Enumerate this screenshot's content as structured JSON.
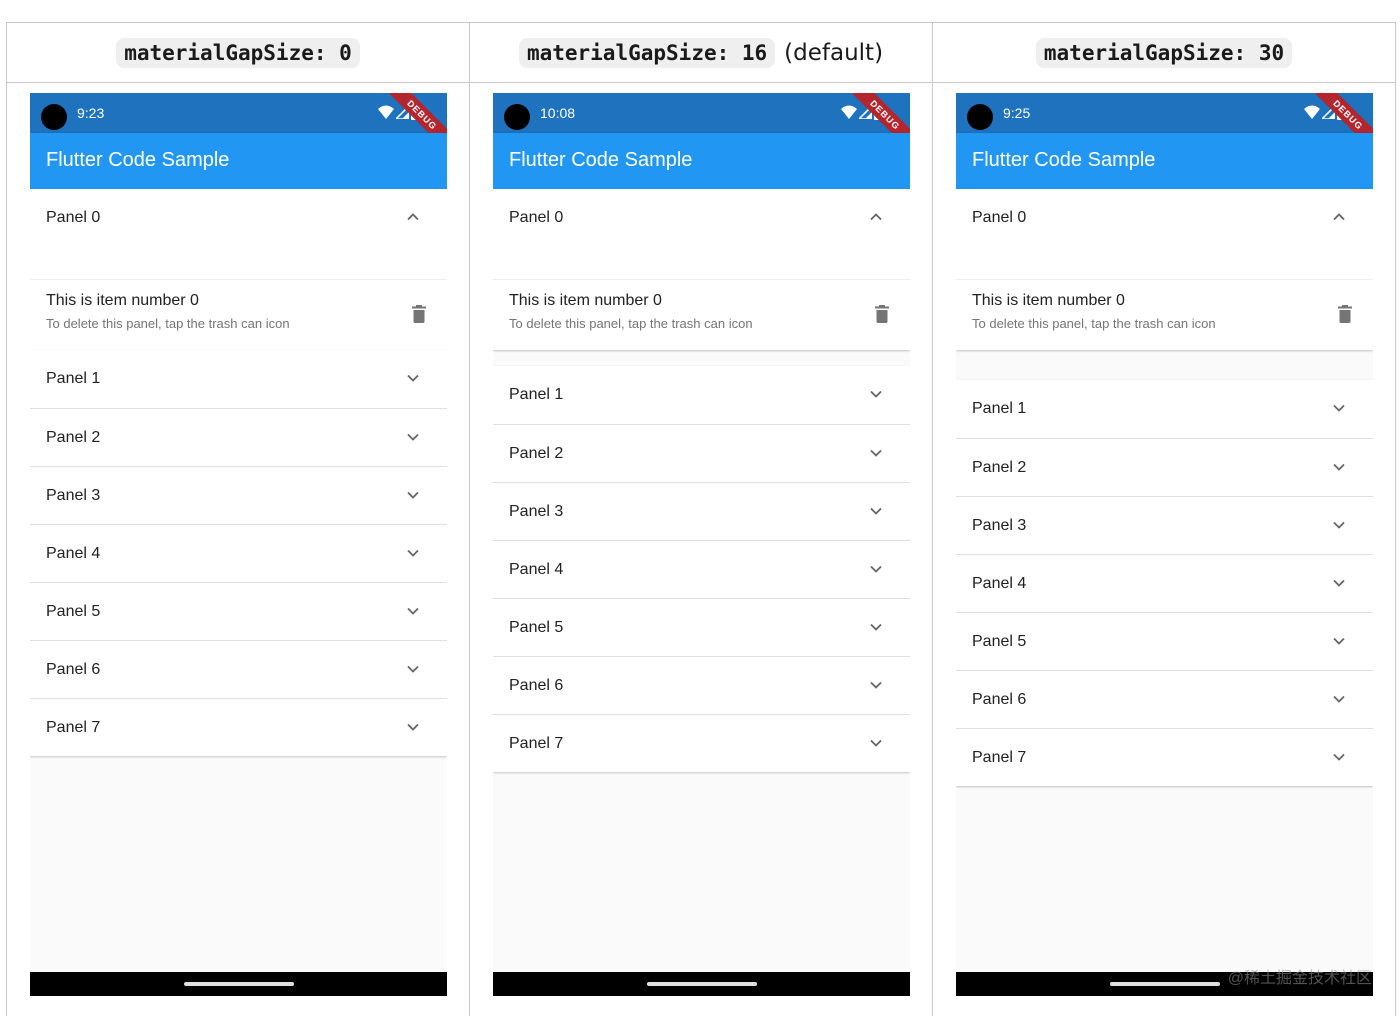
{
  "columns": [
    {
      "label": "materialGapSize: 0",
      "extra": "",
      "gap_size": 0,
      "phone": {
        "time": "9:23",
        "banner": "DEBUG",
        "app_title": "Flutter Code Sample",
        "expanded_panel": "Panel 0",
        "item_title": "This is item number 0",
        "item_subtitle": "To delete this panel, tap the trash can icon",
        "panels": [
          "Panel 1",
          "Panel 2",
          "Panel 3",
          "Panel 4",
          "Panel 5",
          "Panel 6",
          "Panel 7"
        ]
      }
    },
    {
      "label": "materialGapSize: 16",
      "extra": "(default)",
      "gap_size": 16,
      "phone": {
        "time": "10:08",
        "banner": "DEBUG",
        "app_title": "Flutter Code Sample",
        "expanded_panel": "Panel 0",
        "item_title": "This is item number 0",
        "item_subtitle": "To delete this panel, tap the trash can icon",
        "panels": [
          "Panel 1",
          "Panel 2",
          "Panel 3",
          "Panel 4",
          "Panel 5",
          "Panel 6",
          "Panel 7"
        ]
      }
    },
    {
      "label": "materialGapSize: 30",
      "extra": "",
      "gap_size": 30,
      "phone": {
        "time": "9:25",
        "banner": "DEBUG",
        "app_title": "Flutter Code Sample",
        "expanded_panel": "Panel 0",
        "item_title": "This is item number 0",
        "item_subtitle": "To delete this panel, tap the trash can icon",
        "panels": [
          "Panel 1",
          "Panel 2",
          "Panel 3",
          "Panel 4",
          "Panel 5",
          "Panel 6",
          "Panel 7"
        ]
      }
    }
  ],
  "watermark": "@稀土掘金技术社区",
  "icons": {
    "status": [
      "wifi-icon",
      "cell-signal-icon",
      "battery-icon"
    ],
    "panel_expanded": "chevron-up-icon",
    "panel_collapsed": "chevron-down-icon",
    "delete": "trash-icon"
  },
  "colors": {
    "status_bar": "#1e72be",
    "app_bar": "#2196f3",
    "debug_banner": "#b3262e",
    "background": "#fafafa",
    "divider": "#e0e0e0"
  }
}
